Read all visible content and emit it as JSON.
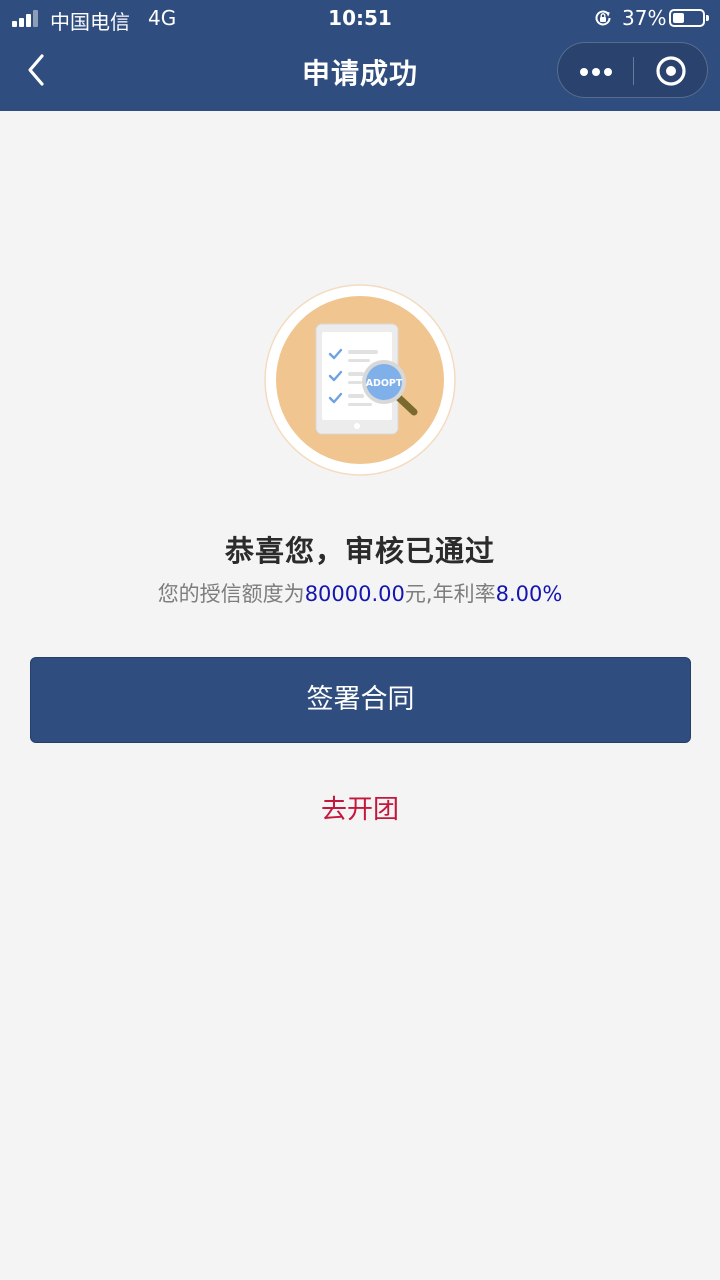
{
  "status_bar": {
    "carrier": "中国电信",
    "network": "4G",
    "time": "10:51",
    "battery": "37%"
  },
  "nav": {
    "title": "申请成功"
  },
  "hero": {
    "badge_text": "ADOPT"
  },
  "result": {
    "headline": "恭喜您，审核已通过",
    "credit_prefix": "您的授信额度为",
    "credit_amount": "80000.00",
    "credit_unit": "元,年利率",
    "rate": "8.00%"
  },
  "actions": {
    "sign_contract": "签署合同",
    "start_group": "去开团"
  },
  "colors": {
    "header": "#2f4d7e",
    "background": "#f4f4f5",
    "highlight": "#1515b0",
    "link": "#c3183d",
    "hero_circle": "#f0c58f"
  }
}
